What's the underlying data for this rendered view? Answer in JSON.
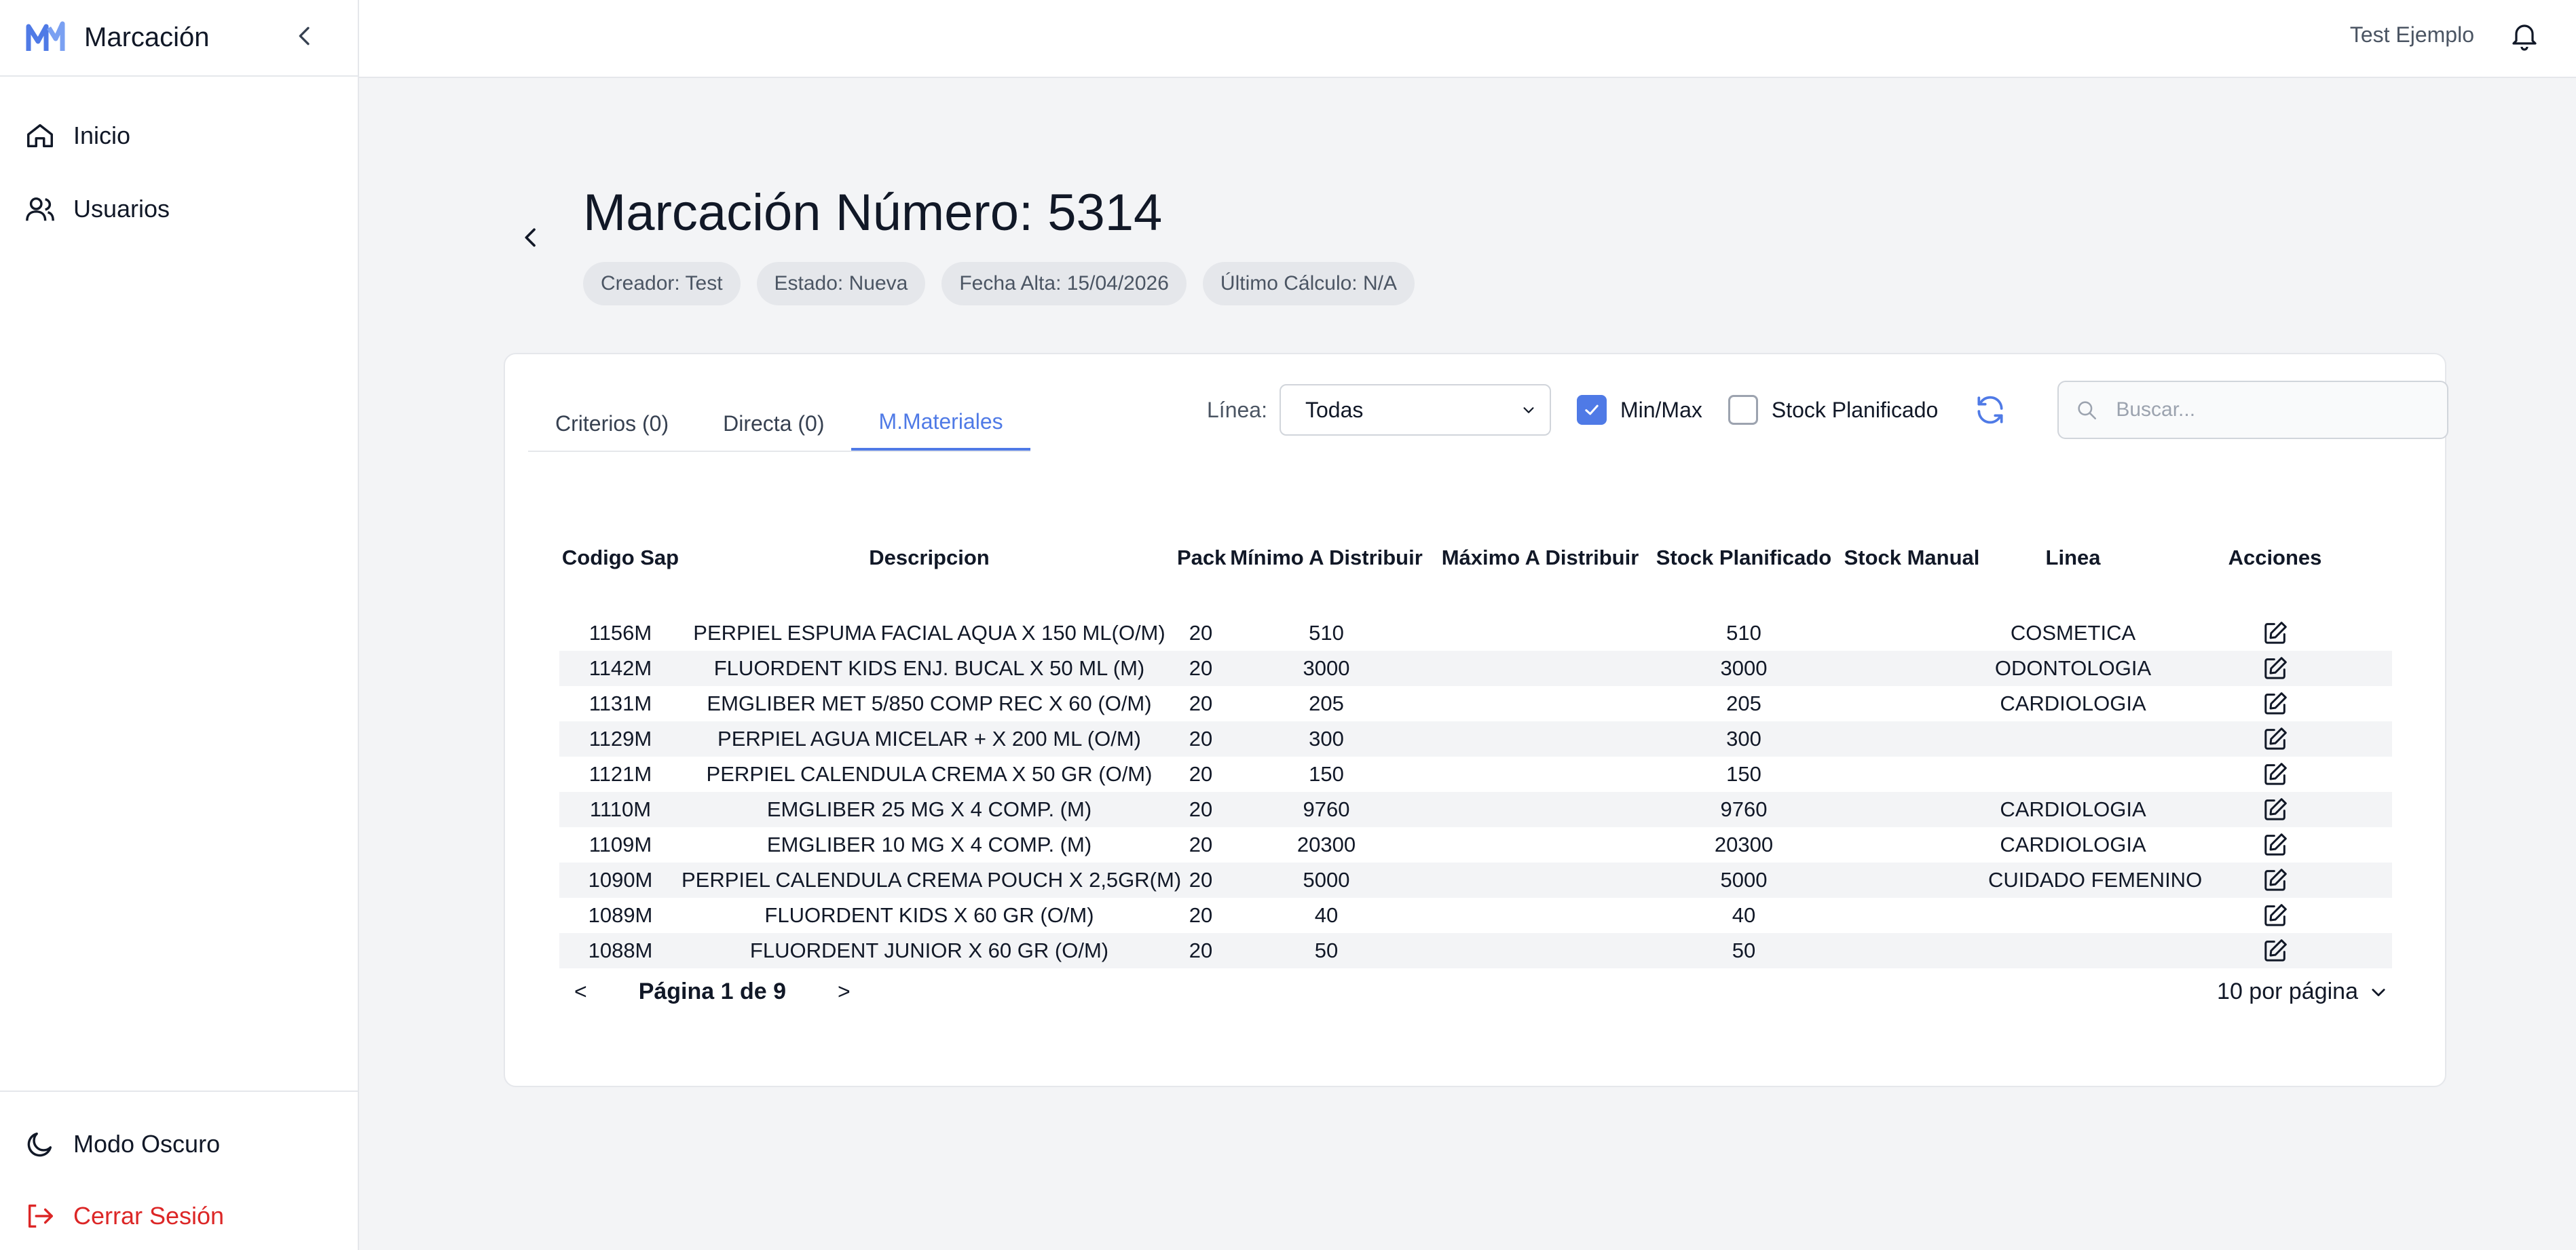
{
  "app": {
    "title": "Marcación"
  },
  "sidebar": {
    "items": [
      {
        "label": "Inicio",
        "icon": "home-icon"
      },
      {
        "label": "Usuarios",
        "icon": "users-icon"
      }
    ],
    "dark_mode": "Modo Oscuro",
    "logout": "Cerrar Sesión"
  },
  "topbar": {
    "user": "Test Ejemplo"
  },
  "header": {
    "title": "Marcación Número: 5314",
    "chips": [
      "Creador: Test",
      "Estado: Nueva",
      "Fecha Alta: 15/04/2026",
      "Último Cálculo: N/A"
    ]
  },
  "tabs": [
    "Criterios (0)",
    "Directa (0)",
    "M.Materiales"
  ],
  "filters": {
    "linea_label": "Línea:",
    "linea_value": "Todas",
    "minmax_label": "Min/Max",
    "minmax_checked": true,
    "stock_label": "Stock Planificado",
    "stock_checked": false,
    "search_placeholder": "Buscar..."
  },
  "table": {
    "headers": [
      "Codigo Sap",
      "Descripcion",
      "Pack",
      "Mínimo A Distribuir",
      "Máximo A Distribuir",
      "Stock Planificado",
      "Stock Manual",
      "Linea",
      "Acciones"
    ],
    "rows": [
      [
        "1156M",
        "PERPIEL ESPUMA FACIAL AQUA X 150 ML(O/M)",
        "20",
        "510",
        "",
        "510",
        "",
        "COSMETICA"
      ],
      [
        "1142M",
        "FLUORDENT KIDS ENJ. BUCAL X 50 ML (M)",
        "20",
        "3000",
        "",
        "3000",
        "",
        "ODONTOLOGIA"
      ],
      [
        "1131M",
        "EMGLIBER MET 5/850 COMP REC X 60 (O/M)",
        "20",
        "205",
        "",
        "205",
        "",
        "CARDIOLOGIA"
      ],
      [
        "1129M",
        "PERPIEL AGUA MICELAR + X 200 ML (O/M)",
        "20",
        "300",
        "",
        "300",
        "",
        ""
      ],
      [
        "1121M",
        "PERPIEL CALENDULA CREMA X 50 GR (O/M)",
        "20",
        "150",
        "",
        "150",
        "",
        ""
      ],
      [
        "1110M",
        "EMGLIBER 25 MG X 4 COMP. (M)",
        "20",
        "9760",
        "",
        "9760",
        "",
        "CARDIOLOGIA"
      ],
      [
        "1109M",
        "EMGLIBER 10 MG X 4 COMP. (M)",
        "20",
        "20300",
        "",
        "20300",
        "",
        "CARDIOLOGIA"
      ],
      [
        "1090M",
        "PERPIEL CALENDULA CREMA POUCH X 2,5GR(M)",
        "20",
        "5000",
        "",
        "5000",
        "",
        "CUIDADO FEMENINO"
      ],
      [
        "1089M",
        "FLUORDENT KIDS X 60 GR (O/M)",
        "20",
        "40",
        "",
        "40",
        "",
        ""
      ],
      [
        "1088M",
        "FLUORDENT JUNIOR X 60 GR (O/M)",
        "20",
        "50",
        "",
        "50",
        "",
        ""
      ]
    ]
  },
  "pagination": {
    "prev": "<",
    "info": "Página 1 de 9",
    "next": ">",
    "per_page": "10 por página"
  },
  "colors": {
    "accent": "#4f7ae6",
    "danger": "#dc2626"
  }
}
